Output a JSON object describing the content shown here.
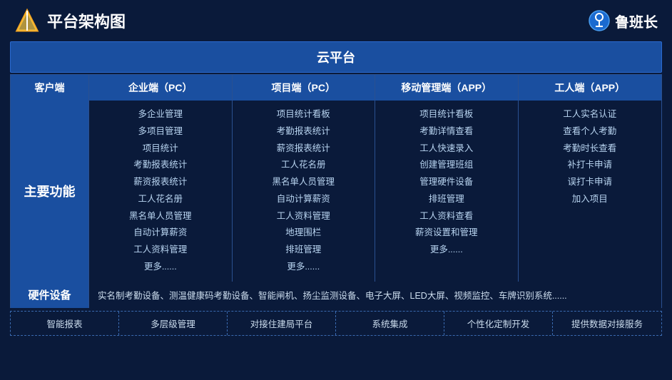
{
  "header": {
    "title": "平台架构图",
    "brand_name": "鲁班长"
  },
  "cloud_platform": {
    "label": "云平台"
  },
  "columns": {
    "client": "客户端",
    "enterprise": "企业端（PC）",
    "project": "项目端（PC）",
    "mobile_mgmt": "移动管理端（APP）",
    "worker": "工人端（APP）"
  },
  "row_label_features": "主要功能",
  "row_label_hardware": "硬件设备",
  "enterprise_features": [
    "多企业管理",
    "多项目管理",
    "项目统计",
    "考勤报表统计",
    "薪资报表统计",
    "工人花名册",
    "黑名单人员管理",
    "自动计算薪资",
    "工人资料管理",
    "更多......"
  ],
  "project_features": [
    "项目统计看板",
    "考勤报表统计",
    "薪资报表统计",
    "工人花名册",
    "黑名单人员管理",
    "自动计算薪资",
    "工人资料管理",
    "地理围栏",
    "排班管理",
    "更多......"
  ],
  "mobile_mgmt_features": [
    "项目统计看板",
    "考勤详情查看",
    "工人快速录入",
    "创建管理班组",
    "管理硬件设备",
    "排班管理",
    "工人资料查看",
    "薪资设置和管理",
    "更多......"
  ],
  "worker_features": [
    "工人实名认证",
    "查看个人考勤",
    "考勤时长查看",
    "补打卡申请",
    "误打卡申请",
    "加入项目"
  ],
  "hardware_content": "实名制考勤设备、测温健康码考勤设备、智能闸机、扬尘监测设备、电子大屏、LED大屏、视频监控、车牌识别系统......",
  "bottom_items": [
    "智能报表",
    "多层级管理",
    "对接住建局平台",
    "系统集成",
    "个性化定制开发",
    "提供数据对接服务"
  ]
}
